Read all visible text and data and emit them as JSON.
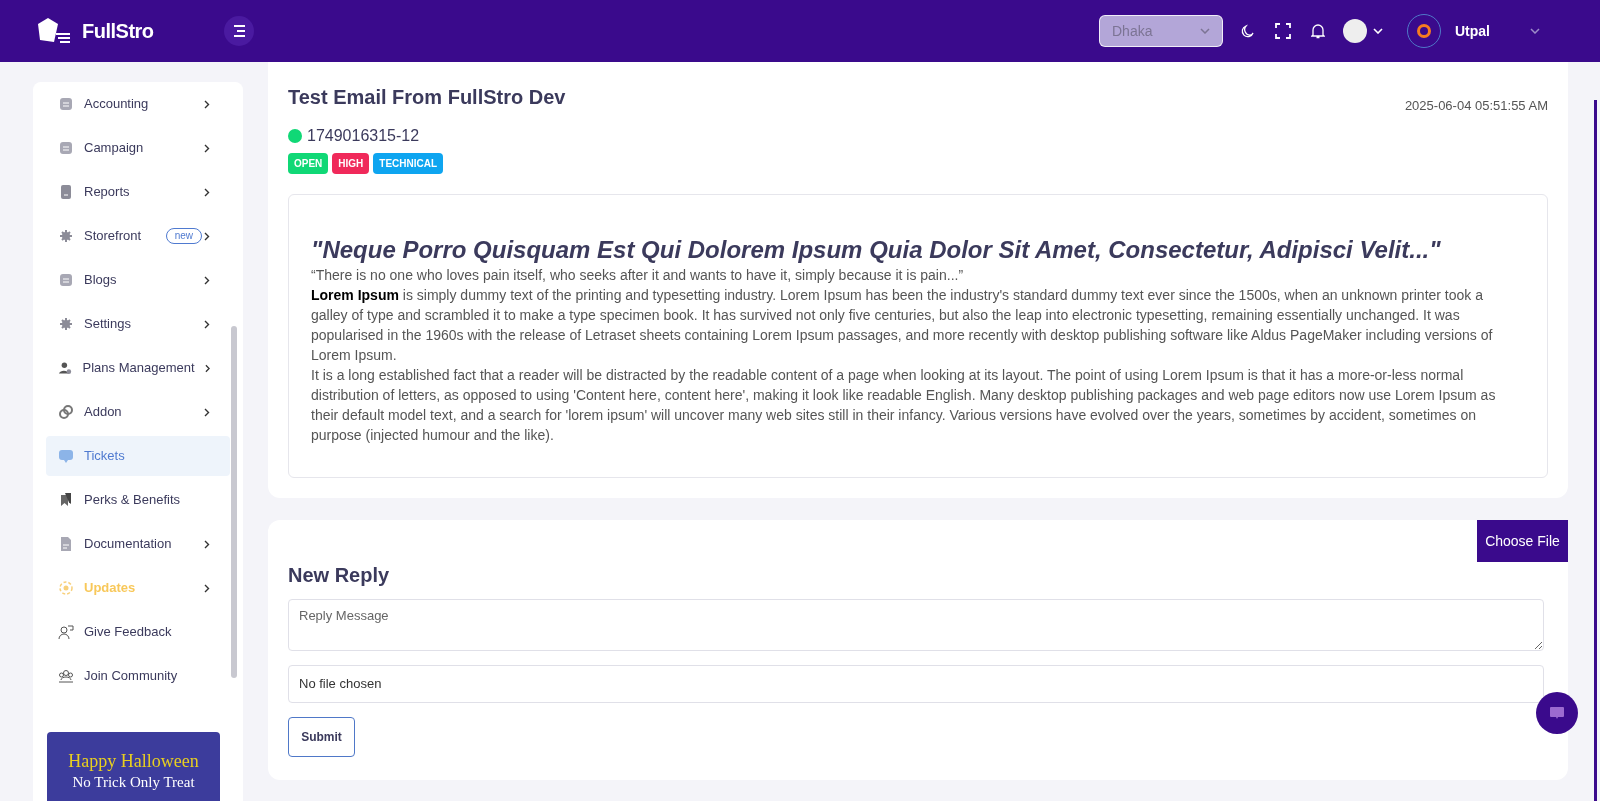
{
  "header": {
    "logo": "FullStro",
    "location": {
      "value": "Dhaka"
    },
    "user": {
      "name": "Utpal"
    }
  },
  "sidebar": {
    "items": [
      {
        "label": "Accounting",
        "kind": "doc",
        "submenu": true,
        "selected": false,
        "highlight": false
      },
      {
        "label": "Campaign",
        "kind": "doc",
        "submenu": true,
        "selected": false,
        "highlight": false
      },
      {
        "label": "Reports",
        "kind": "report",
        "submenu": true,
        "selected": false,
        "highlight": false
      },
      {
        "label": "Storefront",
        "kind": "gear",
        "submenu": true,
        "selected": false,
        "highlight": false,
        "badge": "new"
      },
      {
        "label": "Blogs",
        "kind": "doc",
        "submenu": true,
        "selected": false,
        "highlight": false
      },
      {
        "label": "Settings",
        "kind": "gear",
        "submenu": true,
        "selected": false,
        "highlight": false
      },
      {
        "label": "Plans Management",
        "kind": "user",
        "submenu": true,
        "selected": false,
        "highlight": false
      },
      {
        "label": "Addon",
        "kind": "link",
        "submenu": true,
        "selected": false,
        "highlight": false
      },
      {
        "label": "Tickets",
        "kind": "chat",
        "submenu": false,
        "selected": true,
        "highlight": false
      },
      {
        "label": "Perks & Benefits",
        "kind": "bookmark",
        "submenu": false,
        "selected": false,
        "highlight": false
      },
      {
        "label": "Documentation",
        "kind": "file",
        "submenu": true,
        "selected": false,
        "highlight": false
      },
      {
        "label": "Updates",
        "kind": "target",
        "submenu": true,
        "selected": false,
        "highlight": true
      },
      {
        "label": "Give Feedback",
        "kind": "feedback",
        "submenu": false,
        "selected": false,
        "highlight": false
      },
      {
        "label": "Join Community",
        "kind": "group",
        "submenu": false,
        "selected": false,
        "highlight": false
      }
    ],
    "banner": {
      "title": "Happy Halloween",
      "subtitle": "No Trick Only Treat"
    }
  },
  "ticket": {
    "title": "Test Email From FullStro Dev",
    "date": "2025-06-04 05:51:55 AM",
    "number": "1749016315-12",
    "tags": [
      {
        "label": "OPEN",
        "color": "#10d876"
      },
      {
        "label": "HIGH",
        "color": "#f0295a"
      },
      {
        "label": "TECHNICAL",
        "color": "#0ea5f0"
      }
    ],
    "body": {
      "heading": "\"Neque Porro Quisquam Est Qui Dolorem Ipsum Quia Dolor Sit Amet, Consectetur, Adipisci Velit...\"",
      "paragraphs": [
        "“There is no one who loves pain itself, who seeks after it and wants to have it, simply because it is pain...”",
        "**Lorem Ipsum** is simply dummy text of the printing and typesetting industry. Lorem Ipsum has been the industry's standard dummy text ever since the 1500s, when an unknown printer took a galley of type and scrambled it to make a type specimen book. It has survived not only five centuries, but also the leap into electronic typesetting, remaining essentially unchanged. It was popularised in the 1960s with the release of Letraset sheets containing Lorem Ipsum passages, and more recently with desktop publishing software like Aldus PageMaker including versions of Lorem Ipsum.",
        "It is a long established fact that a reader will be distracted by the readable content of a page when looking at its layout. The point of using Lorem Ipsum is that it has a more-or-less normal distribution of letters, as opposed to using 'Content here, content here', making it look like readable English. Many desktop publishing packages and web page editors now use Lorem Ipsum as their default model text, and a search for 'lorem ipsum' will uncover many web sites still in their infancy. Various versions have evolved over the years, sometimes by accident, sometimes on purpose (injected humour and the like)."
      ]
    }
  },
  "reply": {
    "choose_file": "Choose File",
    "title": "New Reply",
    "message": {
      "placeholder": "Reply Message"
    },
    "file_status": "No file chosen",
    "submit": "Submit"
  }
}
